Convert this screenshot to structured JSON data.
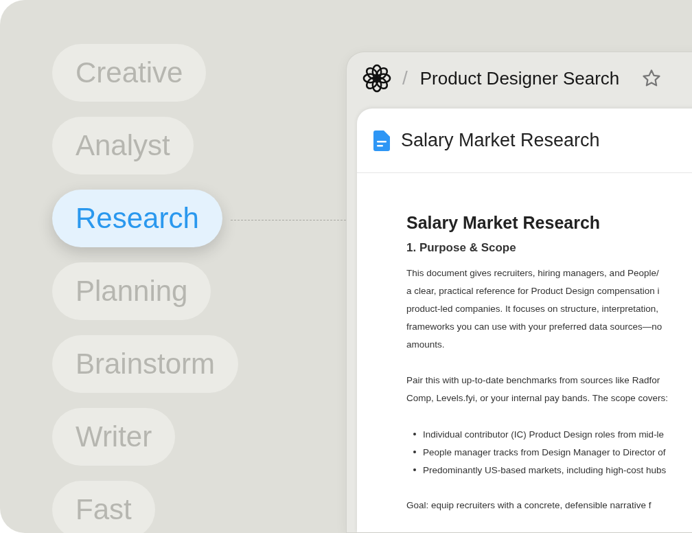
{
  "categories": [
    {
      "label": "Creative",
      "selected": false
    },
    {
      "label": "Analyst",
      "selected": false
    },
    {
      "label": "Research",
      "selected": true
    },
    {
      "label": "Planning",
      "selected": false
    },
    {
      "label": "Brainstorm",
      "selected": false
    },
    {
      "label": "Writer",
      "selected": false
    },
    {
      "label": "Fast",
      "selected": false
    }
  ],
  "window": {
    "separator": "/",
    "title": "Product Designer Search"
  },
  "document": {
    "tab_title": "Salary Market Research",
    "heading": "Salary Market Research",
    "section": "1. Purpose & Scope",
    "blocks": [
      {
        "kind": "paragraph",
        "lines": [
          "This document gives recruiters, hiring managers, and People/",
          "a clear, practical reference for Product Design compensation i",
          "product-led companies. It focuses on structure, interpretation,",
          "frameworks you can use with your preferred data sources—no",
          "amounts."
        ]
      },
      {
        "kind": "paragraph",
        "lines": [
          "Pair this with up-to-date benchmarks from sources like Radfor",
          "Comp, Levels.fyi, or your internal pay bands. The scope covers:"
        ]
      },
      {
        "kind": "bullets",
        "items": [
          "Individual contributor (IC) Product Design roles from mid-le",
          "People manager tracks from Design Manager to Director of",
          "Predominantly US-based markets, including high-cost hubs"
        ]
      },
      {
        "kind": "paragraph",
        "lines": [
          "Goal: equip recruiters with a concrete, defensible narrative f"
        ]
      }
    ]
  }
}
